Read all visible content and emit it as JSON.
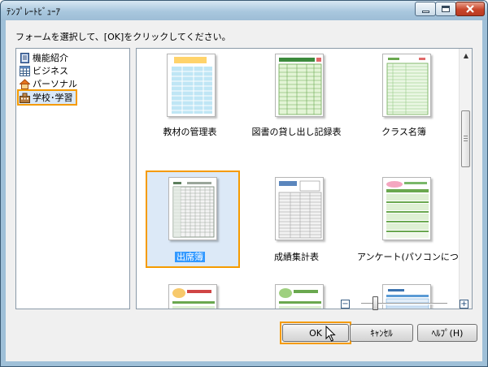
{
  "window": {
    "title": "ﾃﾝﾌﾟﾚｰﾄﾋﾞｭｰｱ"
  },
  "instruction": "フォームを選択して、[OK]をクリックしてください。",
  "categories": [
    {
      "label": "機能紹介",
      "icon": "book-icon",
      "selected": false
    },
    {
      "label": "ビジネス",
      "icon": "grid-icon",
      "selected": false
    },
    {
      "label": "パーソナル",
      "icon": "house-icon",
      "selected": false
    },
    {
      "label": "学校･学習",
      "icon": "school-icon",
      "selected": true
    }
  ],
  "templates": [
    {
      "label": "教材の管理表",
      "selected": false
    },
    {
      "label": "図書の貸し出し記録表",
      "selected": false
    },
    {
      "label": "クラス名簿",
      "selected": false
    },
    {
      "label": "出席簿",
      "selected": true
    },
    {
      "label": "成績集計表",
      "selected": false
    },
    {
      "label": "アンケート(パソコンについて",
      "selected": false
    },
    {
      "label": "",
      "selected": false
    },
    {
      "label": "",
      "selected": false
    },
    {
      "label": "",
      "selected": false
    }
  ],
  "zoom": {
    "minus": "−",
    "plus": "+",
    "level": 0.12
  },
  "buttons": {
    "ok": "OK",
    "cancel": "ｷｬﾝｾﾙ",
    "help": "ﾍﾙﾌﾟ(H)"
  },
  "colors": {
    "highlight": "#f59b00",
    "selection": "#3399ff"
  }
}
